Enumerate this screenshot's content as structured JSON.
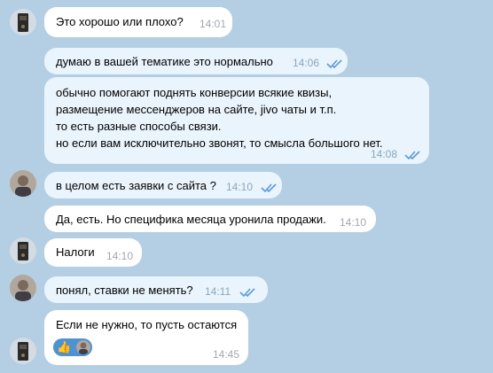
{
  "messages": [
    {
      "text": "Это хорошо или плохо?",
      "time": "14:01"
    },
    {
      "text": "думаю в вашей тематике это нормально",
      "time": "14:06"
    },
    {
      "lines": [
        "обычно помогают поднять конверсии всякие квизы,",
        "размещение мессенджеров на сайте, jivo чаты и т.п.",
        "то есть разные способы связи.",
        "но если вам исключительно звонят, то смысла большого нет."
      ],
      "time": "14:08"
    },
    {
      "text": "в целом есть заявки с сайта ?",
      "time": "14:10"
    },
    {
      "text": "Да, есть. Но специфика месяца уронила продажи.",
      "time": "14:10"
    },
    {
      "text": "Налоги",
      "time": "14:10"
    },
    {
      "text": "понял, ставки не менять?",
      "time": "14:11"
    },
    {
      "text": "Если не нужно, то пусть остаются",
      "time": "14:45",
      "reaction": "👍"
    }
  ],
  "colors": {
    "background": "#b4cfe3",
    "incoming_bubble": "#ffffff",
    "outgoing_bubble": "#eaf4fc",
    "check": "#5b9bd5",
    "reaction_pill": "#4f92d1"
  },
  "icons": {
    "read_receipt": "double-check-icon",
    "reaction": "thumbs-up"
  }
}
